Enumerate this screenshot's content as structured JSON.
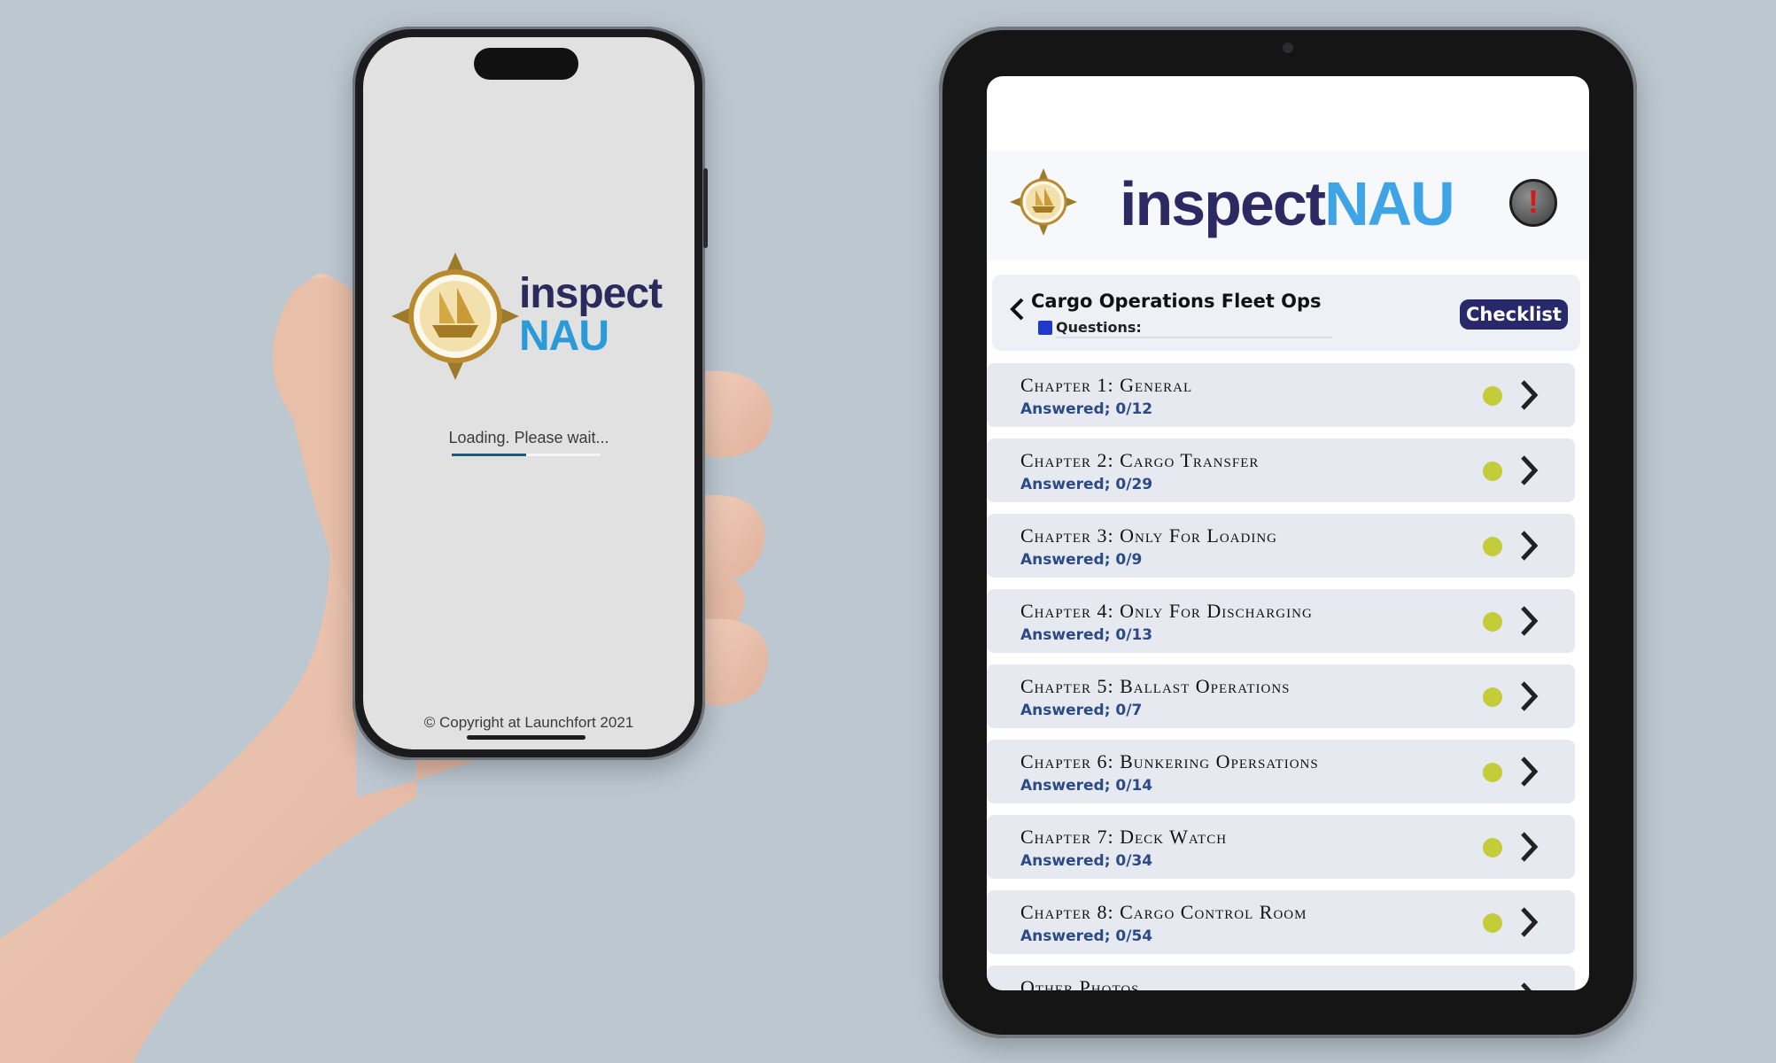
{
  "colors": {
    "background": "#bcc7d0",
    "brand_dark": "#2d2a63",
    "brand_blue": "#3ea4e6",
    "answered_blue": "#2b4a86",
    "status_dot": "#c4cc3a",
    "checklist_button": "#28296a"
  },
  "phone": {
    "brand_line1": "inspect",
    "brand_line2": "NAU",
    "loading_text": "Loading. Please wait...",
    "progress": 0.5,
    "copyright": "© Copyright at Launchfort 2021"
  },
  "tablet": {
    "brand_part1": "inspect",
    "brand_part2": "NAU",
    "alert_icon": "!",
    "page_title": "Cargo Operations Fleet Ops",
    "questions_label": "Questions:",
    "checklist_label": "Checklist",
    "chapters": [
      {
        "title": "Chapter 1: General",
        "answered": "Answered; 0/12"
      },
      {
        "title": "Chapter 2: Cargo Transfer",
        "answered": "Answered; 0/29"
      },
      {
        "title": "Chapter 3: Only For Loading",
        "answered": "Answered; 0/9"
      },
      {
        "title": "Chapter 4: Only For Discharging",
        "answered": "Answered; 0/13"
      },
      {
        "title": "Chapter 5: Ballast Operations",
        "answered": "Answered; 0/7"
      },
      {
        "title": "Chapter 6: Bunkering Opersations",
        "answered": "Answered; 0/14"
      },
      {
        "title": "Chapter 7: Deck Watch",
        "answered": "Answered; 0/34"
      },
      {
        "title": "Chapter 8: Cargo Control Room",
        "answered": "Answered; 0/54"
      },
      {
        "title": "Other Photos",
        "answered": ""
      }
    ]
  }
}
